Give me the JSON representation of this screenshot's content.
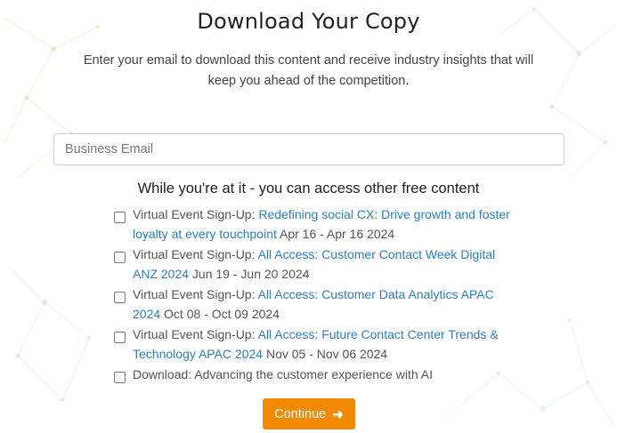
{
  "form": {
    "title": "Download Your Copy",
    "subtitle": "Enter your email to download this content and receive industry insights that will keep you ahead of the competition.",
    "email_placeholder": "Business Email",
    "email_value": "",
    "section_heading": "While you're at it - you can access other free content",
    "offers": [
      {
        "prefix": "Virtual Event Sign-Up: ",
        "link": "Redefining social CX: Drive growth and foster loyalty at every touchpoint",
        "suffix": " Apr 16 - Apr 16 2024",
        "checked": false
      },
      {
        "prefix": "Virtual Event Sign-Up: ",
        "link": "All Access: Customer Contact Week Digital ANZ 2024",
        "suffix": " Jun 19 - Jun 20 2024",
        "checked": false
      },
      {
        "prefix": "Virtual Event Sign-Up: ",
        "link": "All Access: Customer Data Analytics APAC 2024",
        "suffix": " Oct 08 - Oct 09 2024",
        "checked": false
      },
      {
        "prefix": "Virtual Event Sign-Up: ",
        "link": "All Access: Future Contact Center Trends & Technology APAC 2024",
        "suffix": " Nov 05 - Nov 06 2024",
        "checked": false
      },
      {
        "prefix": "Download: Advancing the customer experience with AI",
        "link": "",
        "suffix": "",
        "checked": false
      }
    ],
    "continue_label": "Continue",
    "continue_icon": "arrow-right-icon",
    "accent_color": "#f18a00",
    "link_color": "#2a7fc8"
  }
}
